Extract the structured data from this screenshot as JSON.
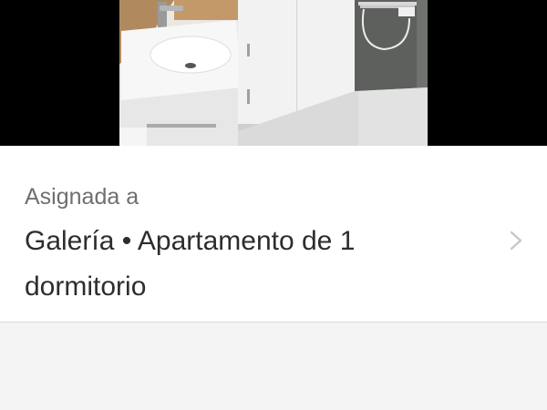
{
  "colors": {
    "page_background": "#f4f4f4",
    "card_background": "#ffffff",
    "sublabel_text": "#6f6f6f",
    "title_text": "#2d2d2d",
    "chevron": "#c7c7cc",
    "photo_letterbox": "#000000"
  },
  "photo": {
    "subject": "bathroom-vanity-photo"
  },
  "assignment": {
    "label": "Asignada a",
    "value": "Galería • Apartamento de 1 dormitorio",
    "chevron_icon": "chevron-right-icon"
  }
}
